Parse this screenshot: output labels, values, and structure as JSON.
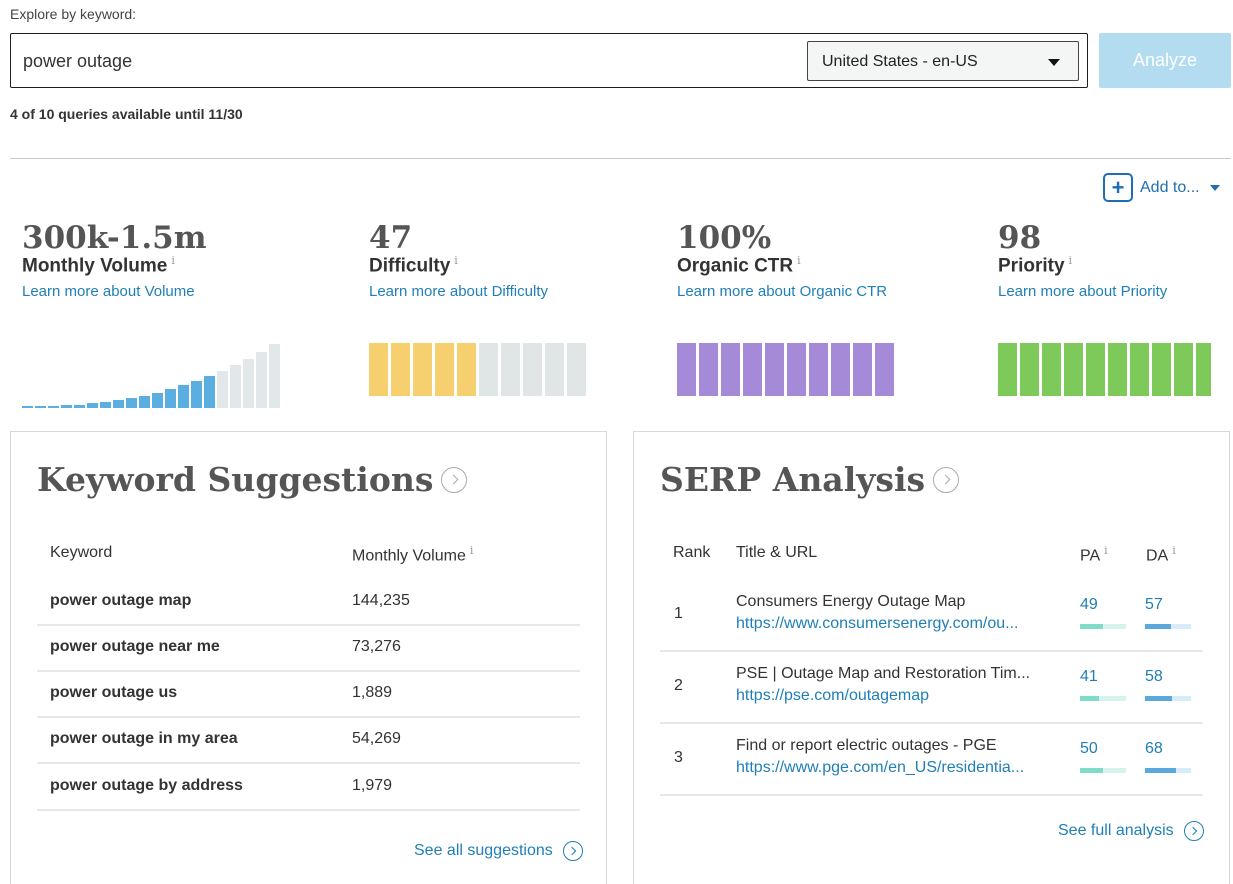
{
  "search": {
    "label": "Explore by keyword:",
    "query": "power outage",
    "locale": "United States - en-US",
    "analyze_label": "Analyze",
    "quota_text": "4 of 10 queries available until 11/30"
  },
  "actions": {
    "add_to_label": "Add to..."
  },
  "metrics": {
    "volume": {
      "value": "300k-1.5m",
      "title": "Monthly Volume",
      "info": "i",
      "link": "Learn more about Volume",
      "bars_filled": 15,
      "bars_total": 20
    },
    "difficulty": {
      "value": "47",
      "title": "Difficulty",
      "info": "i",
      "link": "Learn more about Difficulty",
      "segments_filled": 5,
      "segments_total": 10
    },
    "ctr": {
      "value": "100%",
      "title": "Organic CTR",
      "info": "i",
      "link": "Learn more about Organic CTR",
      "segments_filled": 10,
      "segments_total": 10
    },
    "priority": {
      "value": "98",
      "title": "Priority",
      "info": "i",
      "link": "Learn more about Priority",
      "segments_filled": 10,
      "segments_total": 10,
      "last_fraction": 0.8
    }
  },
  "colors": {
    "volume_fill": "#5aaee0",
    "volume_empty": "#e2e7e9",
    "difficulty_fill": "#f6cf6e",
    "difficulty_empty": "#e0e5e6",
    "ctr_fill": "#a58ad8",
    "priority_fill": "#7dca5a",
    "pa_fill": "#7fdcc8",
    "pa_track": "#d6f4ed",
    "da_fill": "#5aa8dc",
    "da_track": "#d7ecf8"
  },
  "keyword_suggestions": {
    "title": "Keyword Suggestions",
    "col_keyword": "Keyword",
    "col_volume": "Monthly Volume",
    "info": "i",
    "rows": [
      {
        "keyword": "power outage map",
        "volume": "144,235"
      },
      {
        "keyword": "power outage near me",
        "volume": "73,276"
      },
      {
        "keyword": "power outage us",
        "volume": "1,889"
      },
      {
        "keyword": "power outage in my area",
        "volume": "54,269"
      },
      {
        "keyword": "power outage by address",
        "volume": "1,979"
      }
    ],
    "see_all": "See all suggestions"
  },
  "serp": {
    "title": "SERP Analysis",
    "col_rank": "Rank",
    "col_title": "Title & URL",
    "col_pa": "PA",
    "col_da": "DA",
    "info": "i",
    "rows": [
      {
        "rank": "1",
        "title": "Consumers Energy Outage Map",
        "url": "https://www.consumersenergy.com/ou...",
        "pa": "49",
        "da": "57"
      },
      {
        "rank": "2",
        "title": "PSE | Outage Map and Restoration Tim...",
        "url": "https://pse.com/outagemap",
        "pa": "41",
        "da": "58"
      },
      {
        "rank": "3",
        "title": "Find or report electric outages - PGE",
        "url": "https://www.pge.com/en_US/residentia...",
        "pa": "50",
        "da": "68"
      }
    ],
    "see_full": "See full analysis"
  }
}
